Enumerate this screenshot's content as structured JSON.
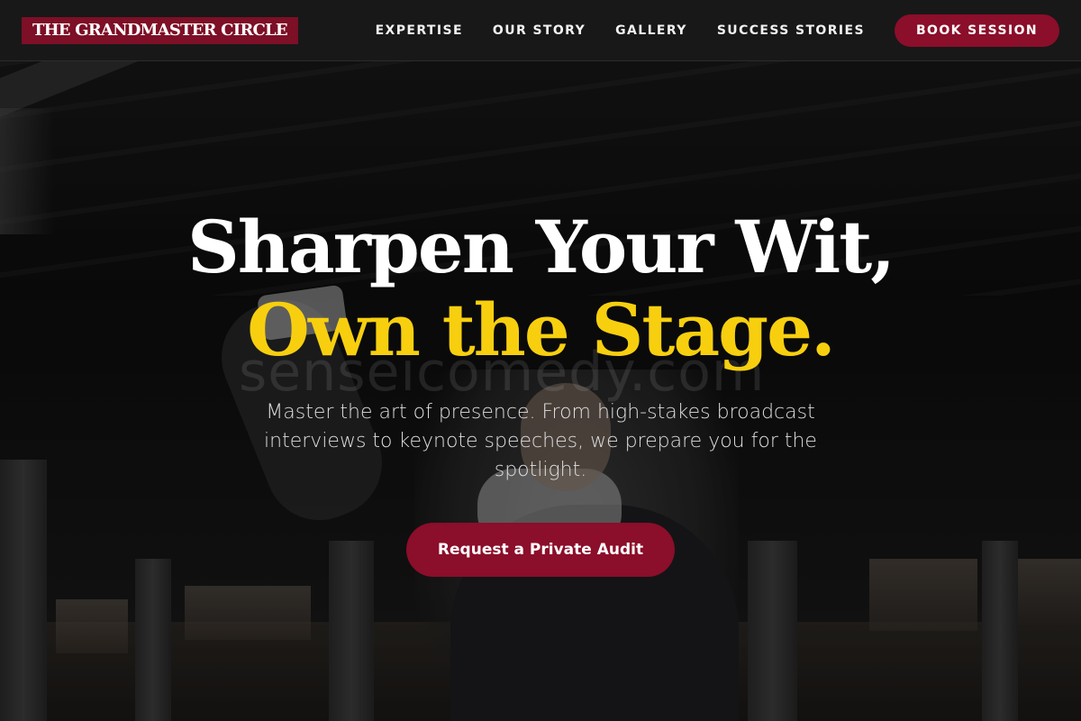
{
  "header": {
    "logo_text": "THE GRANDMASTER CIRCLE",
    "nav": [
      "EXPERTISE",
      "OUR STORY",
      "GALLERY",
      "SUCCESS STORIES"
    ],
    "book_label": "BOOK SESSION"
  },
  "hero": {
    "headline_line1": "Sharpen Your Wit,",
    "headline_line2": "Own the Stage.",
    "subtitle": "Master the art of presence. From high-stakes broadcast interviews to keynote speeches, we prepare you for the spotlight.",
    "cta_label": "Request a Private Audit",
    "watermark": "senseicomedy.com"
  },
  "colors": {
    "brand_red": "#8b0e2a",
    "accent_yellow": "#f7cf0f",
    "nav_bg": "#181818"
  }
}
